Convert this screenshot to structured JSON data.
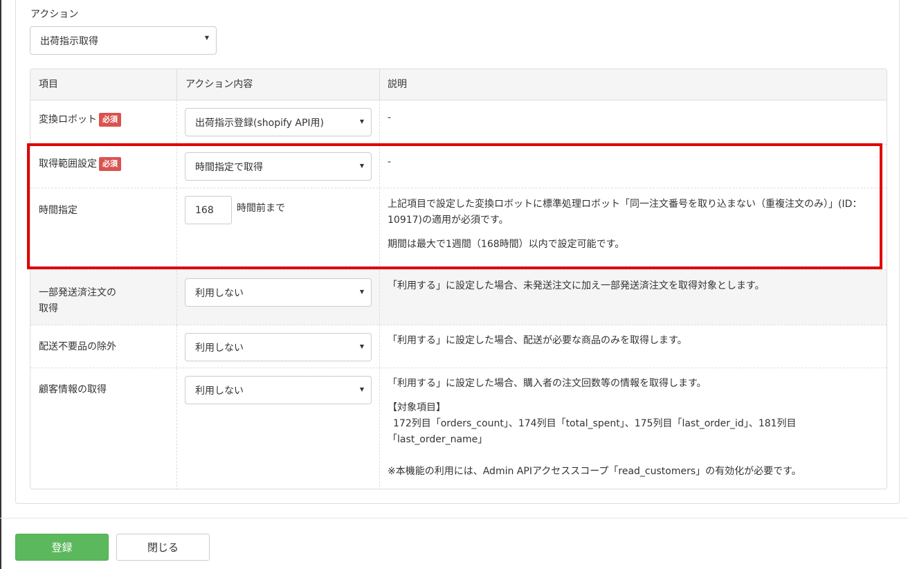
{
  "action": {
    "label": "アクション",
    "selected": "出荷指示取得"
  },
  "table": {
    "headers": [
      "項目",
      "アクション内容",
      "説明"
    ],
    "required_badge": "必須",
    "rows": {
      "robot": {
        "label": "変換ロボット",
        "value": "出荷指示登録(shopify API用)",
        "desc": "-"
      },
      "range": {
        "label": "取得範囲設定",
        "value": "時間指定で取得",
        "desc": "-"
      },
      "time": {
        "label": "時間指定",
        "value": "168",
        "suffix": "時間前まで",
        "desc1": "上記項目で設定した変換ロボットに標準処理ロボット「同一注文番号を取り込まない（重複注文のみ）」(ID：10917)の適用が必須です。",
        "desc2": "期間は最大で1週間（168時間）以内で設定可能です。"
      },
      "partial": {
        "label_line1": "一部発送済注文の",
        "label_line2": "取得",
        "value": "利用しない",
        "desc": "「利用する」に設定した場合、未発送注文に加え一部発送済注文を取得対象とします。"
      },
      "shipping": {
        "label": "配送不要品の除外",
        "value": "利用しない",
        "desc": "「利用する」に設定した場合、配送が必要な商品のみを取得します。"
      },
      "customer": {
        "label": "顧客情報の取得",
        "value": "利用しない",
        "desc1": "「利用する」に設定した場合、購入者の注文回数等の情報を取得します。",
        "desc_heading": "【対象項目】",
        "desc_items": "172列目「orders_count」、174列目「total_spent」、175列目「last_order_id」、181列目「last_order_name」",
        "desc_note": "※本機能の利用には、Admin APIアクセススコープ「read_customers」の有効化が必要です。"
      }
    }
  },
  "buttons": {
    "register": "登録",
    "close": "閉じる"
  },
  "colors": {
    "highlight": "#e00000",
    "badge": "#d9534f",
    "register": "#5cb85c"
  }
}
